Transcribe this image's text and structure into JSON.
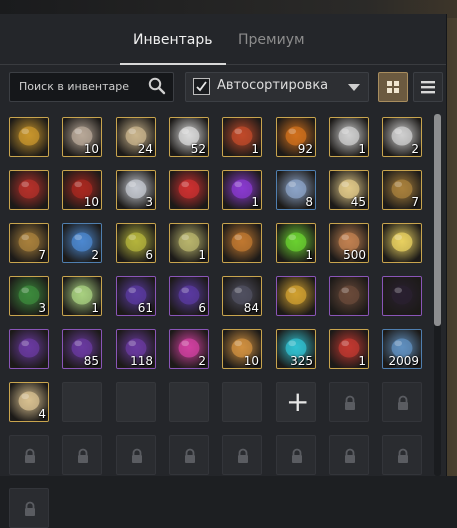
{
  "tabs": [
    {
      "label": "Инвентарь",
      "active": true
    },
    {
      "label": "Премиум",
      "active": false
    }
  ],
  "search": {
    "placeholder": "Поиск в инвентаре"
  },
  "autosort": {
    "label": "Автосортировка",
    "checked": true
  },
  "view_modes": [
    {
      "name": "grid",
      "active": true
    },
    {
      "name": "list",
      "active": false
    }
  ],
  "items": [
    {
      "name": "gold-bar",
      "count": "",
      "frame": "gold",
      "color": "#c8962c"
    },
    {
      "name": "cow-egg",
      "count": "10",
      "frame": "gold",
      "color": "#b8a898"
    },
    {
      "name": "scroll-envelope",
      "count": "24",
      "frame": "gold",
      "color": "#c9b48c"
    },
    {
      "name": "ticket-stack",
      "count": "52",
      "frame": "gold",
      "color": "#d9d9d9"
    },
    {
      "name": "creature-figure",
      "count": "1",
      "frame": "gold",
      "color": "#c04a2a"
    },
    {
      "name": "fire-orb",
      "count": "92",
      "frame": "gold",
      "color": "#d0701c"
    },
    {
      "name": "silver-tree",
      "count": "1",
      "frame": "gold",
      "color": "#cfcfcf"
    },
    {
      "name": "silver-tree",
      "count": "2",
      "frame": "gold",
      "color": "#cfcfcf"
    },
    {
      "name": "red-chest",
      "count": "",
      "frame": "gold",
      "color": "#b4302a"
    },
    {
      "name": "red-box",
      "count": "10",
      "frame": "gold",
      "color": "#a82820"
    },
    {
      "name": "silver-chest",
      "count": "3",
      "frame": "gold",
      "color": "#c4c8d0"
    },
    {
      "name": "gift-box",
      "count": "",
      "frame": "gold",
      "color": "#cc3030"
    },
    {
      "name": "purple-rune",
      "count": "1",
      "frame": "gold",
      "color": "#8a3ad0"
    },
    {
      "name": "steel-chest",
      "count": "8",
      "frame": "blue",
      "color": "#8ca4c8"
    },
    {
      "name": "pouch",
      "count": "45",
      "frame": "gold",
      "color": "#e0c888"
    },
    {
      "name": "card",
      "count": "7",
      "frame": "gold",
      "color": "#a8803c"
    },
    {
      "name": "card",
      "count": "7",
      "frame": "gold",
      "color": "#a8803c"
    },
    {
      "name": "blue-card",
      "count": "2",
      "frame": "blue",
      "color": "#4c88d0"
    },
    {
      "name": "green-card",
      "count": "6",
      "frame": "gold",
      "color": "#b4b43c"
    },
    {
      "name": "ticket",
      "count": "1",
      "frame": "gold",
      "color": "#b8b46c"
    },
    {
      "name": "wood-chest",
      "count": "",
      "frame": "gold",
      "color": "#c07830"
    },
    {
      "name": "green-crystal",
      "count": "1",
      "frame": "gold",
      "color": "#6ad030"
    },
    {
      "name": "hammer-tool",
      "count": "500",
      "frame": "gold",
      "color": "#c08050"
    },
    {
      "name": "butterfly",
      "count": "",
      "frame": "gold",
      "color": "#e8d060"
    },
    {
      "name": "green-gift",
      "count": "3",
      "frame": "gold",
      "color": "#3c8a3c"
    },
    {
      "name": "light-gift",
      "count": "1",
      "frame": "gold",
      "color": "#a8d080"
    },
    {
      "name": "dark-crystal",
      "count": "61",
      "frame": "purple",
      "color": "#5a3aa0"
    },
    {
      "name": "dark-crystal",
      "count": "6",
      "frame": "purple",
      "color": "#5a3aa0"
    },
    {
      "name": "dark-cone",
      "count": "84",
      "frame": "gold",
      "color": "#505060"
    },
    {
      "name": "golden-staff",
      "count": "",
      "frame": "purple",
      "color": "#d0a030"
    },
    {
      "name": "axe",
      "count": "",
      "frame": "purple",
      "color": "#6a4a3a"
    },
    {
      "name": "dark-gauntlet",
      "count": "",
      "frame": "purple",
      "color": "#2a2030"
    },
    {
      "name": "shadow-shard",
      "count": "",
      "frame": "purple",
      "color": "#6a3aa0"
    },
    {
      "name": "shadow-shard",
      "count": "85",
      "frame": "purple",
      "color": "#6a3aa0"
    },
    {
      "name": "shadow-shard",
      "count": "118",
      "frame": "purple",
      "color": "#6a3aa0"
    },
    {
      "name": "magic-swirl",
      "count": "2",
      "frame": "purple",
      "color": "#d040a0"
    },
    {
      "name": "jar",
      "count": "10",
      "frame": "gold",
      "color": "#d09040"
    },
    {
      "name": "cyan-orb",
      "count": "325",
      "frame": "gold",
      "color": "#30c0d0"
    },
    {
      "name": "gold-trunk",
      "count": "1",
      "frame": "gold",
      "color": "#c03830"
    },
    {
      "name": "potion",
      "count": "2009",
      "frame": "blue",
      "color": "#6090c0"
    },
    {
      "name": "cookie",
      "count": "4",
      "frame": "gold",
      "color": "#d8c090"
    }
  ],
  "unlock_slot": {
    "label": "+"
  },
  "empty_slots": 4,
  "locked_slots": 3,
  "locked_row": 8
}
